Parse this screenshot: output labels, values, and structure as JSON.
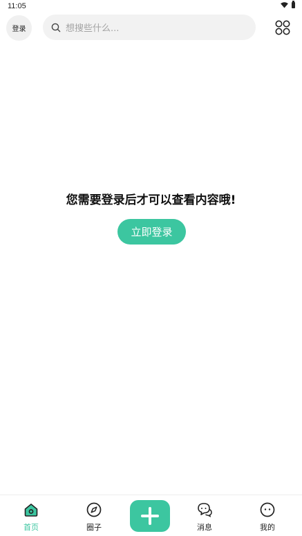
{
  "status_bar": {
    "time": "11:05"
  },
  "header": {
    "login_label": "登录",
    "search_placeholder": "想搜些什么..."
  },
  "main": {
    "empty_message": "您需要登录后才可以查看内容哦!",
    "login_button_label": "立即登录"
  },
  "tab_bar": {
    "items": [
      {
        "label": "首页",
        "icon": "home-icon",
        "active": true
      },
      {
        "label": "圈子",
        "icon": "compass-icon",
        "active": false
      },
      {
        "label": "消息",
        "icon": "chat-bubbles-icon",
        "active": false
      },
      {
        "label": "我的",
        "icon": "profile-face-icon",
        "active": false
      }
    ],
    "publish_icon": "plus-icon"
  },
  "colors": {
    "accent": "#3cc6a0",
    "search_bg": "#f2f2f2",
    "placeholder": "#a3a3a3"
  }
}
